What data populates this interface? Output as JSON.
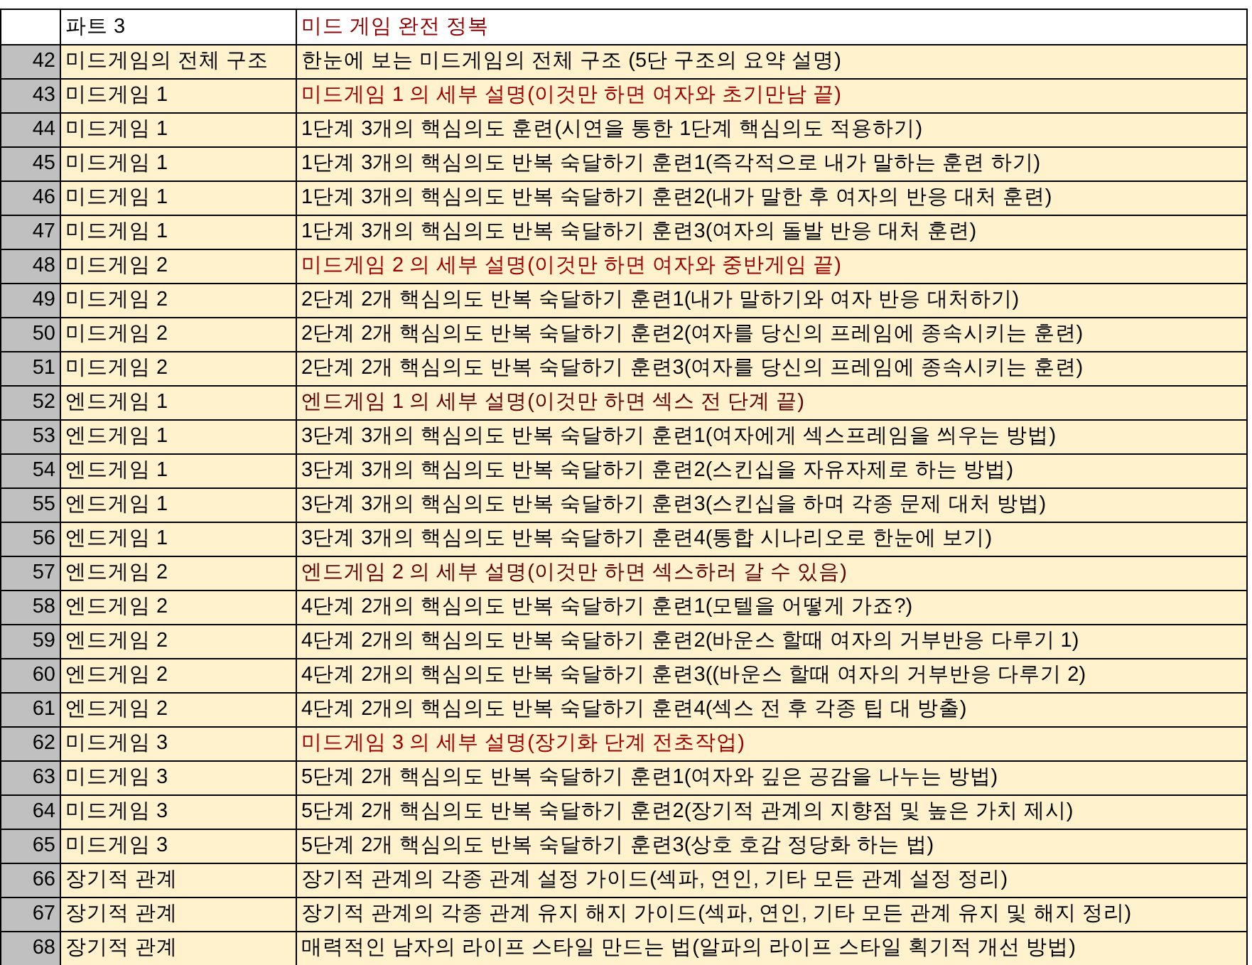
{
  "header": {
    "part": "파트 3",
    "title": "미드 게임 완전 정복",
    "color": "#900000"
  },
  "rows": [
    {
      "number": "42",
      "section": "미드게임의 전체 구조",
      "description": "한눈에 보는 미드게임의 전체 구조 (5단 구조의 요약 설명)"
    },
    {
      "number": "43",
      "section": "미드게임 1",
      "description": "미드게임 1 의 세부 설명(이것만 하면 여자와 초기만남 끝)",
      "color": "#a00000"
    },
    {
      "number": "44",
      "section": "미드게임 1",
      "description": "1단계 3개의 핵심의도 훈련(시연을 통한 1단계 핵심의도 적용하기)"
    },
    {
      "number": "45",
      "section": "미드게임 1",
      "description": "1단계 3개의 핵심의도 반복 숙달하기 훈련1(즉각적으로 내가 말하는 훈련 하기)"
    },
    {
      "number": "46",
      "section": "미드게임 1",
      "description": "1단계 3개의 핵심의도 반복 숙달하기 훈련2(내가 말한 후 여자의 반응 대처 훈련)"
    },
    {
      "number": "47",
      "section": "미드게임 1",
      "description": "1단계 3개의 핵심의도 반복 숙달하기 훈련3(여자의 돌발 반응 대처 훈련)"
    },
    {
      "number": "48",
      "section": "미드게임 2",
      "description": "미드게임 2 의 세부 설명(이것만 하면 여자와 중반게임 끝)",
      "color": "#a00000"
    },
    {
      "number": "49",
      "section": "미드게임 2",
      "description": "2단계 2개 핵심의도 반복 숙달하기 훈련1(내가 말하기와 여자 반응 대처하기)"
    },
    {
      "number": "50",
      "section": "미드게임 2",
      "description": "2단계 2개 핵심의도 반복 숙달하기 훈련2(여자를 당신의 프레임에 종속시키는 훈련)"
    },
    {
      "number": "51",
      "section": "미드게임 2",
      "description": "2단계 2개 핵심의도 반복 숙달하기 훈련3(여자를 당신의 프레임에 종속시키는 훈련)"
    },
    {
      "number": "52",
      "section": "엔드게임 1",
      "description": "엔드게임 1 의 세부 설명(이것만 하면 섹스 전 단계 끝)",
      "color": "#600000"
    },
    {
      "number": "53",
      "section": "엔드게임 1",
      "description": "3단계 3개의 핵심의도 반복 숙달하기 훈련1(여자에게 섹스프레임을 씌우는 방법)"
    },
    {
      "number": "54",
      "section": "엔드게임 1",
      "description": "3단계 3개의 핵심의도 반복 숙달하기 훈련2(스킨십을 자유자제로 하는 방법)"
    },
    {
      "number": "55",
      "section": "엔드게임 1",
      "description": "3단계 3개의 핵심의도 반복 숙달하기 훈련3(스킨십을 하며 각종 문제 대처 방법)"
    },
    {
      "number": "56",
      "section": "엔드게임 1",
      "description": "3단계 3개의 핵심의도 반복 숙달하기 훈련4(통합 시나리오로 한눈에 보기)"
    },
    {
      "number": "57",
      "section": "엔드게임 2",
      "description": "엔드게임 2 의 세부 설명(이것만 하면 섹스하러 갈 수 있음)",
      "color": "#600000"
    },
    {
      "number": "58",
      "section": "엔드게임 2",
      "description": "4단계 2개의 핵심의도 반복 숙달하기 훈련1(모텔을 어떻게 가죠?)"
    },
    {
      "number": "59",
      "section": "엔드게임 2",
      "description": "4단계 2개의 핵심의도 반복 숙달하기 훈련2(바운스 할때 여자의 거부반응 다루기 1)"
    },
    {
      "number": "60",
      "section": "엔드게임 2",
      "description": "4단계 2개의 핵심의도 반복 숙달하기 훈련3((바운스 할때 여자의 거부반응 다루기 2)"
    },
    {
      "number": "61",
      "section": "엔드게임 2",
      "description": "4단계 2개의 핵심의도 반복 숙달하기 훈련4(섹스 전 후 각종 팁 대 방출)"
    },
    {
      "number": "62",
      "section": "미드게임 3",
      "description": "미드게임 3 의 세부 설명(장기화 단계 전초작업)",
      "color": "#a00000"
    },
    {
      "number": "63",
      "section": "미드게임 3",
      "description": "5단계 2개 핵심의도 반복 숙달하기 훈련1(여자와 깊은 공감을 나누는 방법)"
    },
    {
      "number": "64",
      "section": "미드게임 3",
      "description": "5단계 2개 핵심의도 반복 숙달하기 훈련2(장기적 관계의 지향점 및 높은 가치 제시)"
    },
    {
      "number": "65",
      "section": "미드게임 3",
      "description": "5단계 2개 핵심의도 반복 숙달하기 훈련3(상호 호감 정당화 하는 법)"
    },
    {
      "number": "66",
      "section": "장기적 관계",
      "description": "장기적 관계의 각종 관계 설정 가이드(섹파, 연인, 기타 모든 관계 설정 정리)"
    },
    {
      "number": "67",
      "section": "장기적 관계",
      "description": "장기적 관계의 각종 관계 유지 해지 가이드(섹파, 연인, 기타 모든 관계 유지 및 해지 정리)"
    },
    {
      "number": "68",
      "section": "장기적 관계",
      "description": "매력적인 남자의 라이프 스타일 만드는 법(알파의 라이프 스타일 획기적 개선 방법)"
    }
  ]
}
